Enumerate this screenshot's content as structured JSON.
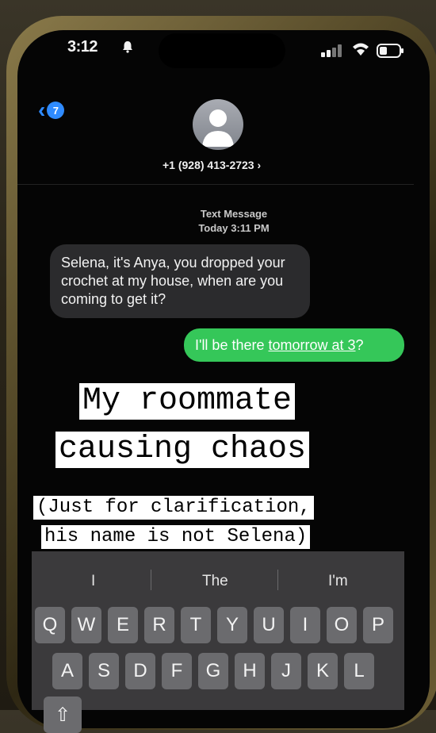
{
  "status_bar": {
    "time": "3:12"
  },
  "header": {
    "back_count": "7",
    "contact_name": "+1 (928) 413-2723 ›"
  },
  "conversation": {
    "timestamp_line1": "Text Message",
    "timestamp_line2": "Today 3:11 PM",
    "incoming_message": "Selena, it's Anya, you dropped your crochet at my house, when are you coming to get it?",
    "outgoing_prefix": "I'll be there ",
    "outgoing_link": "tomorrow at 3",
    "outgoing_suffix": "?"
  },
  "captions": {
    "line1": "My roommate",
    "line2": "causing chaos",
    "line3": "(Just for clarification,",
    "line4": "his name is not Selena)"
  },
  "keyboard": {
    "suggestions": [
      "I",
      "The",
      "I'm"
    ],
    "row1": [
      "Q",
      "W",
      "E",
      "R",
      "T",
      "Y",
      "U",
      "I",
      "O",
      "P"
    ],
    "row2": [
      "A",
      "S",
      "D",
      "F",
      "G",
      "H",
      "J",
      "K",
      "L"
    ]
  },
  "colors": {
    "imessage_blue": "#2f8bff",
    "sms_green": "#35c759",
    "incoming_bubble": "#2b2b2d"
  }
}
